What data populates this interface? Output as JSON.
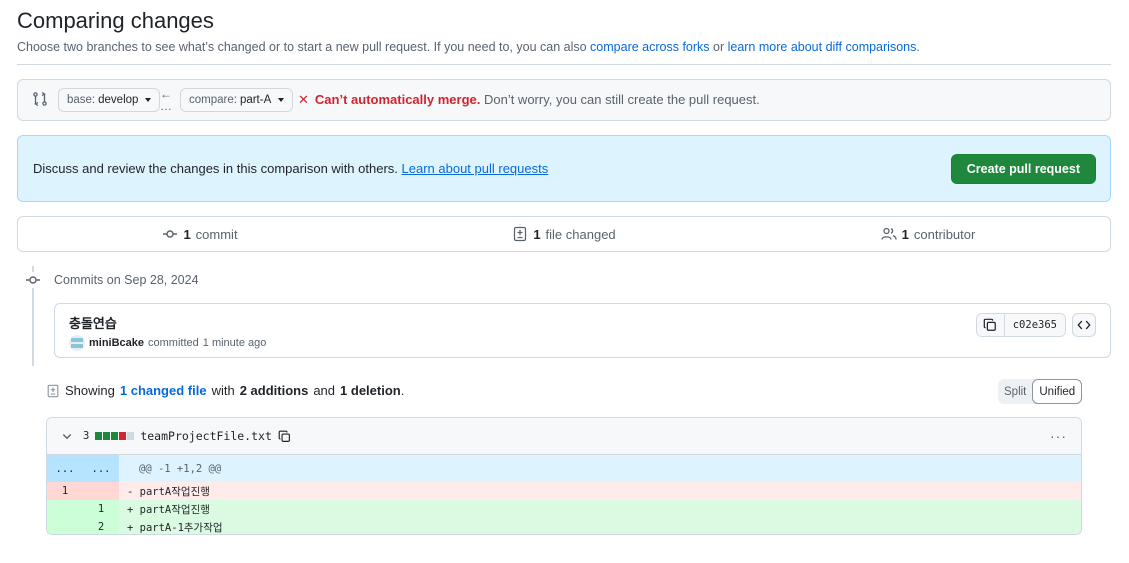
{
  "page": {
    "title": "Comparing changes",
    "subtitle_prefix": "Choose two branches to see what’s changed or to start a new pull request. If you need to, you can also ",
    "subtitle_link1": "compare across forks",
    "subtitle_mid": " or ",
    "subtitle_link2": "learn more about diff comparisons",
    "subtitle_suffix": "."
  },
  "range": {
    "base_label": "base:",
    "base_branch": "develop",
    "compare_label": "compare:",
    "compare_branch": "part-A",
    "merge_status_bad": "Can’t automatically merge.",
    "merge_status_text": " Don’t worry, you can still create the pull request."
  },
  "discuss": {
    "text": "Discuss and review the changes in this comparison with others. ",
    "link": "Learn about pull requests",
    "create_button": "Create pull request"
  },
  "stats": {
    "commits_count": "1",
    "commits_label": "commit",
    "files_count": "1",
    "files_label": "file changed",
    "contributors_count": "1",
    "contributors_label": "contributor"
  },
  "commits": {
    "date_heading": "Commits on Sep 28, 2024",
    "items": [
      {
        "message": "충돌연습",
        "author": "miniBcake",
        "action": "committed",
        "time": "1 minute ago",
        "sha": "c02e365"
      }
    ]
  },
  "summary": {
    "showing": "Showing",
    "changed_files": "1 changed file",
    "with": "with",
    "additions": "2 additions",
    "and": "and",
    "deletions": "1 deletion",
    "period": ".",
    "split_label": "Split",
    "unified_label": "Unified"
  },
  "file": {
    "changes_count": "3",
    "name": "teamProjectFile.txt",
    "diffstat": [
      "add",
      "add",
      "add",
      "del",
      "neutral"
    ],
    "lines": [
      {
        "type": "hunk",
        "old": "...",
        "new": "...",
        "text": "@@ -1 +1,2 @@"
      },
      {
        "type": "del",
        "old": "1",
        "new": "",
        "text": "- partA작업진행"
      },
      {
        "type": "add",
        "old": "",
        "new": "1",
        "text": "+ partA작업진행"
      },
      {
        "type": "add",
        "old": "",
        "new": "2",
        "text": "+ partA-1추가작업"
      }
    ]
  },
  "colors": {
    "accent": "#0969da",
    "success": "#1f883d",
    "danger": "#d1242f"
  }
}
